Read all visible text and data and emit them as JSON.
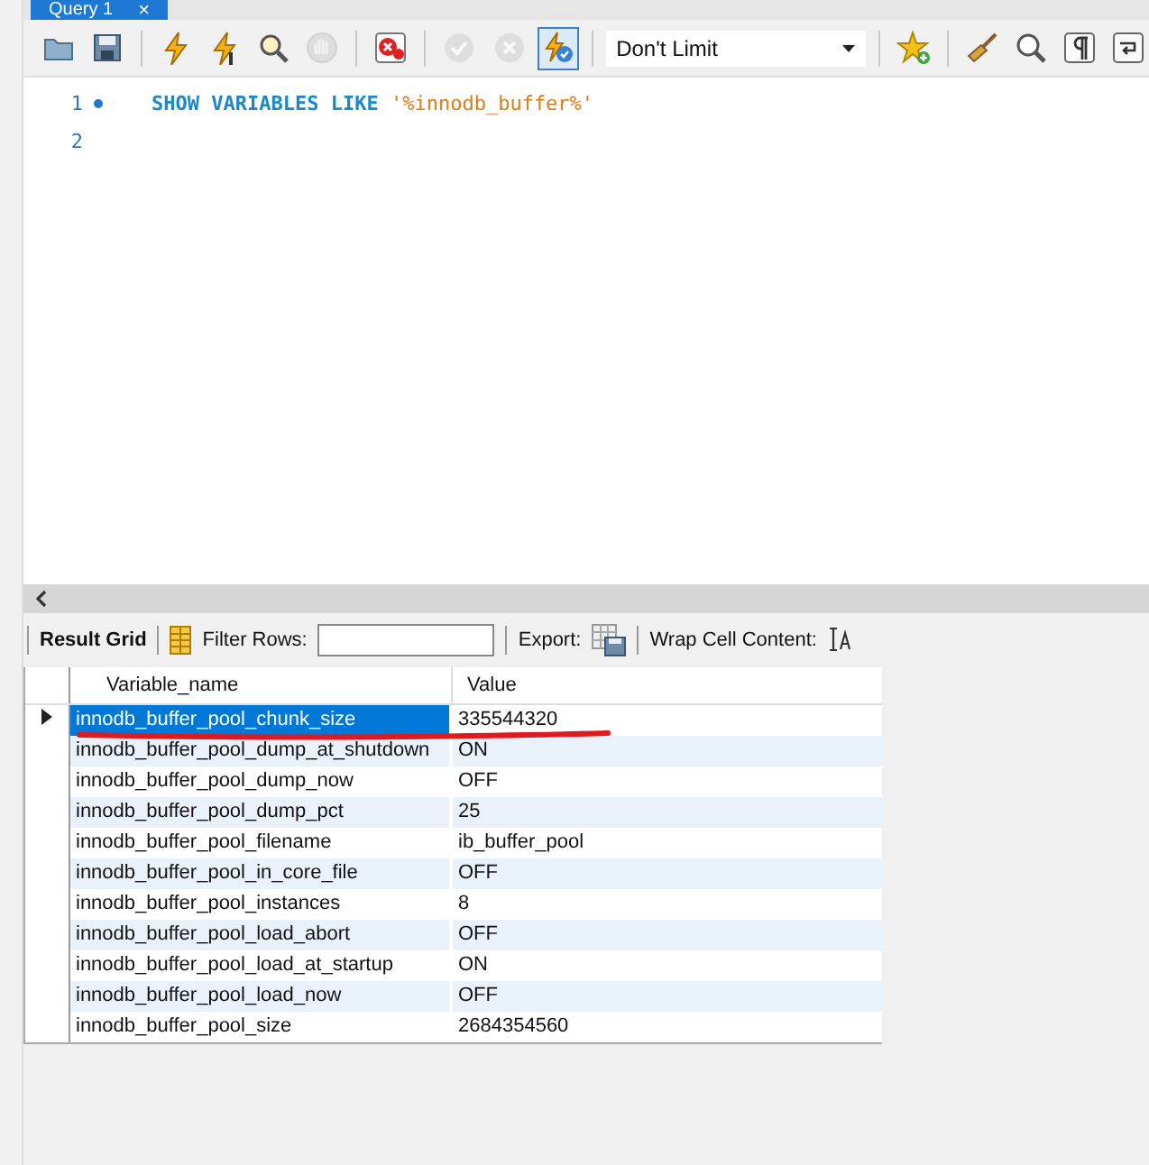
{
  "tab": {
    "title": "Query 1",
    "close": "×"
  },
  "toolbar": [
    {
      "kind": "open",
      "disabled": false,
      "selected": false
    },
    {
      "kind": "save",
      "disabled": false,
      "selected": false
    },
    {
      "kind": "sep"
    },
    {
      "kind": "execute",
      "disabled": false,
      "selected": false
    },
    {
      "kind": "execute-current",
      "disabled": false,
      "selected": false
    },
    {
      "kind": "explain",
      "disabled": false,
      "selected": false
    },
    {
      "kind": "stop",
      "disabled": true,
      "selected": false
    },
    {
      "kind": "sep"
    },
    {
      "kind": "error-toggle",
      "disabled": false,
      "selected": false
    },
    {
      "kind": "sep"
    },
    {
      "kind": "commit",
      "disabled": true,
      "selected": false
    },
    {
      "kind": "rollback",
      "disabled": true,
      "selected": false
    },
    {
      "kind": "autocommit",
      "disabled": false,
      "selected": true
    },
    {
      "kind": "sep"
    },
    {
      "kind": "limit",
      "value": "Don't Limit"
    },
    {
      "kind": "sep"
    },
    {
      "kind": "snippet",
      "disabled": false,
      "selected": false
    },
    {
      "kind": "sep"
    },
    {
      "kind": "beautify",
      "disabled": false,
      "selected": false
    },
    {
      "kind": "find",
      "disabled": false,
      "selected": false
    },
    {
      "kind": "invisibles",
      "disabled": false,
      "selected": false
    },
    {
      "kind": "wrap",
      "disabled": false,
      "selected": false
    }
  ],
  "editor": {
    "lines": [
      {
        "number": "1",
        "marker": true,
        "tokens": [
          {
            "kind": "keyword",
            "text": "SHOW VARIABLES LIKE"
          },
          {
            "kind": "string",
            "text": "'%innodb_buffer%'"
          }
        ]
      },
      {
        "number": "2",
        "marker": false
      }
    ]
  },
  "result_toolbar": {
    "grid_label": "Result Grid",
    "filter_label": "Filter Rows:",
    "export_label": "Export:",
    "wrap_label": "Wrap Cell Content:"
  },
  "grid": {
    "columns": [
      "Variable_name",
      "Value"
    ],
    "rows": [
      {
        "name": "innodb_buffer_pool_chunk_size",
        "value": "335544320",
        "selected": true
      },
      {
        "name": "innodb_buffer_pool_dump_at_shutdown",
        "value": "ON",
        "selected": false
      },
      {
        "name": "innodb_buffer_pool_dump_now",
        "value": "OFF",
        "selected": false
      },
      {
        "name": "innodb_buffer_pool_dump_pct",
        "value": "25",
        "selected": false
      },
      {
        "name": "innodb_buffer_pool_filename",
        "value": "ib_buffer_pool",
        "selected": false
      },
      {
        "name": "innodb_buffer_pool_in_core_file",
        "value": "OFF",
        "selected": false
      },
      {
        "name": "innodb_buffer_pool_instances",
        "value": "8",
        "selected": false
      },
      {
        "name": "innodb_buffer_pool_load_abort",
        "value": "OFF",
        "selected": false
      },
      {
        "name": "innodb_buffer_pool_load_at_startup",
        "value": "ON",
        "selected": false
      },
      {
        "name": "innodb_buffer_pool_load_now",
        "value": "OFF",
        "selected": false
      },
      {
        "name": "innodb_buffer_pool_size",
        "value": "2684354560",
        "selected": false
      }
    ]
  }
}
